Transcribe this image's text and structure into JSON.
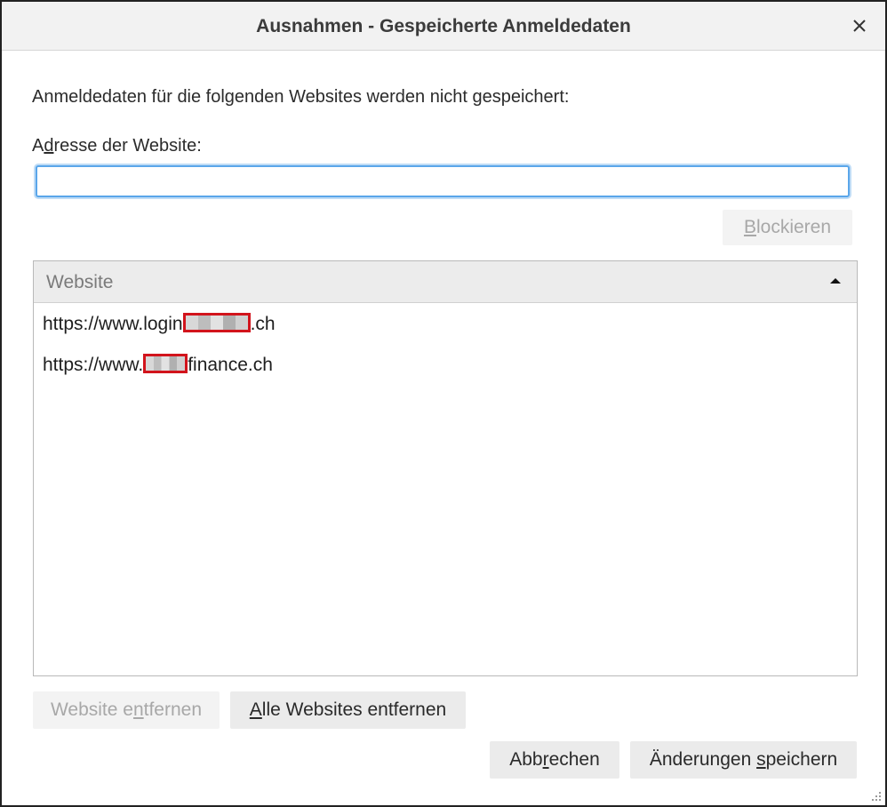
{
  "window": {
    "title": "Ausnahmen - Gespeicherte Anmeldedaten",
    "close_icon": "close-icon"
  },
  "intro_text": "Anmeldedaten für die folgenden Websites werden nicht gespeichert:",
  "address": {
    "label_pre": "",
    "label_accel": "A",
    "label_mid": "d",
    "label_rest": "resse der Website:",
    "value": "",
    "placeholder": ""
  },
  "block_button": {
    "accel": "B",
    "rest": "lockieren",
    "disabled": true
  },
  "list": {
    "header": "Website",
    "sort_direction": "ascending",
    "rows": [
      {
        "prefix": "https://www.login",
        "suffix": ".ch",
        "redacted": true
      },
      {
        "prefix": "https://www.",
        "suffix": "finance.ch",
        "redacted": true
      }
    ]
  },
  "buttons": {
    "remove": {
      "pre": "Website e",
      "accel": "n",
      "post": "tfernen",
      "disabled": true
    },
    "remove_all": {
      "pre": "",
      "accel": "A",
      "post": "lle Websites entfernen",
      "disabled": false
    },
    "cancel": {
      "pre": "Abb",
      "accel": "r",
      "post": "echen"
    },
    "save": {
      "pre": "Änderungen ",
      "accel": "s",
      "post": "peichern"
    }
  },
  "colors": {
    "focus_ring": "#5aa6ea",
    "redaction_border": "#d2141c"
  }
}
